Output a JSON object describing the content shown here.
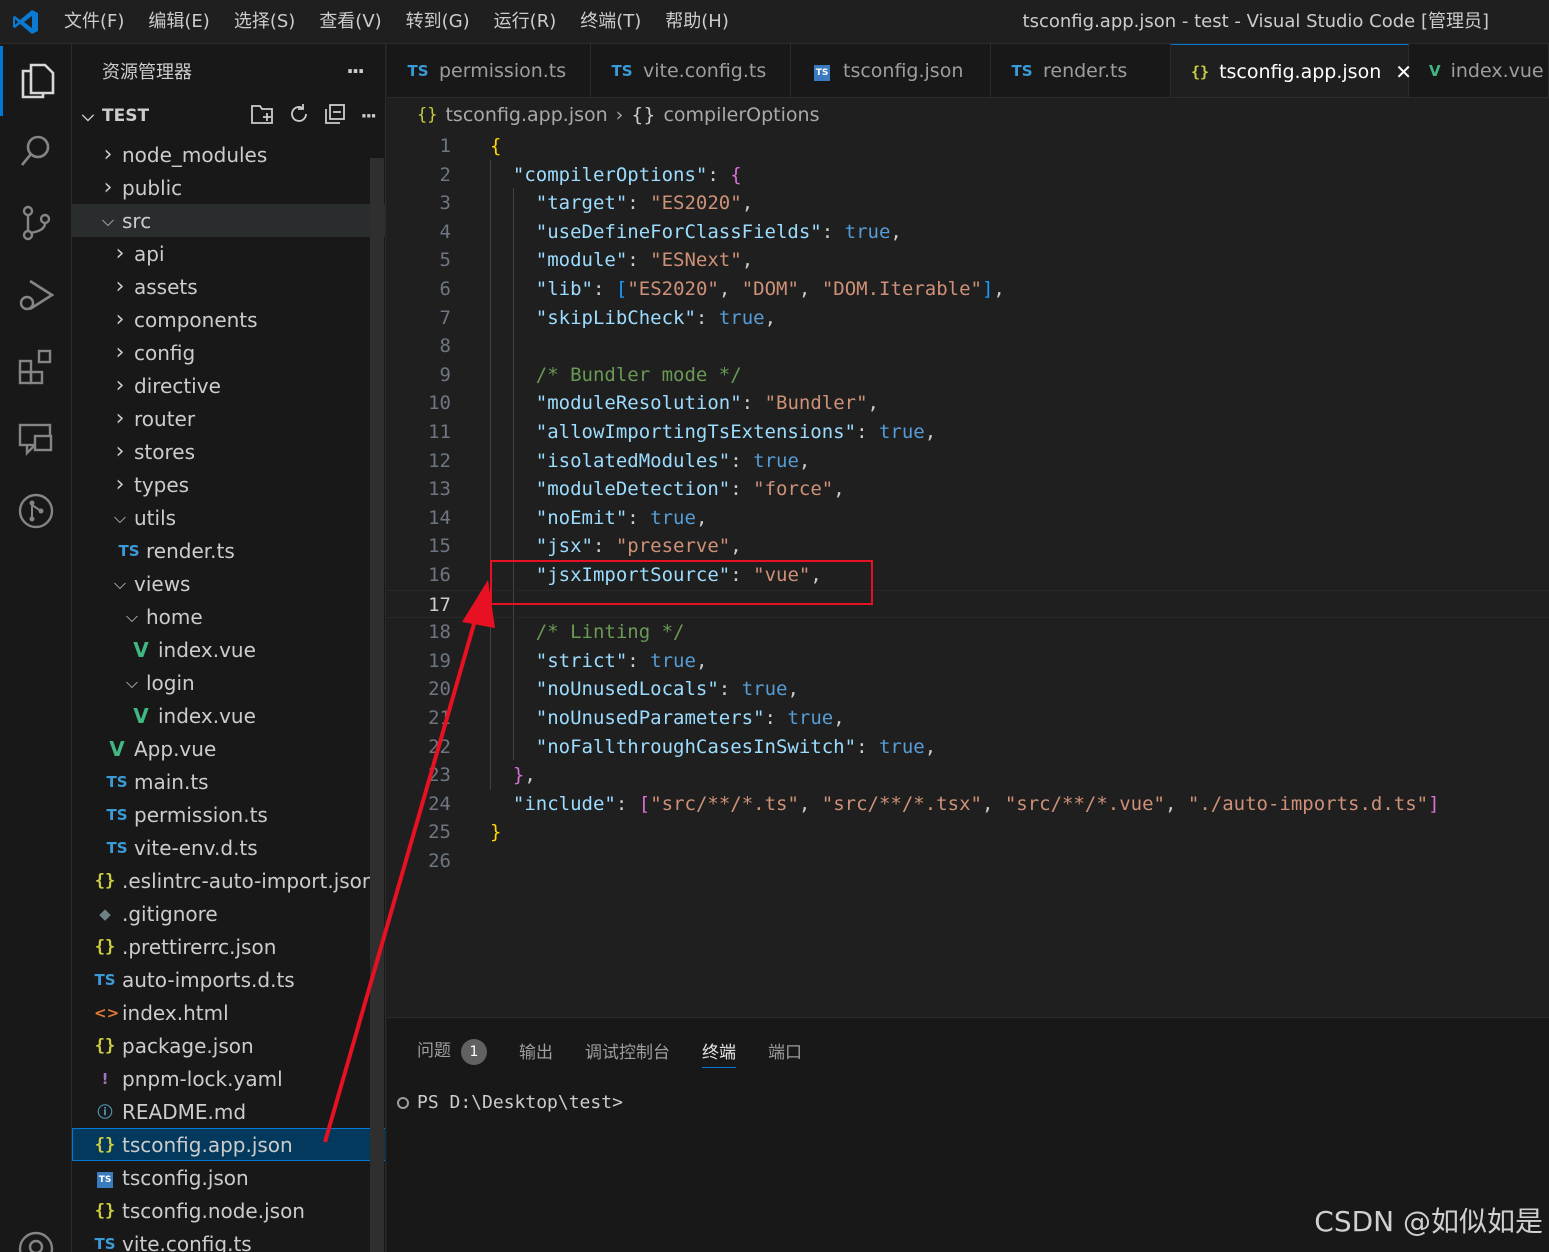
{
  "titlebar": {
    "menus": [
      "文件(F)",
      "编辑(E)",
      "选择(S)",
      "查看(V)",
      "转到(G)",
      "运行(R)",
      "终端(T)",
      "帮助(H)"
    ],
    "window_title": "tsconfig.app.json - test - Visual Studio Code [管理员]"
  },
  "activitybar": {
    "icons": [
      "explorer-icon",
      "search-icon",
      "source-control-icon",
      "run-debug-icon",
      "extensions-icon",
      "remote-chat-icon",
      "git-graph-icon",
      "account-icon"
    ]
  },
  "sidebar": {
    "title": "资源管理器",
    "more": "···",
    "section": "TEST",
    "tree": [
      {
        "label": "node_modules",
        "kind": "folder",
        "open": false
      },
      {
        "label": "public",
        "kind": "folder",
        "open": false
      },
      {
        "label": "src",
        "kind": "folder",
        "open": true
      },
      {
        "label": "api",
        "kind": "folder",
        "open": false
      },
      {
        "label": "assets",
        "kind": "folder",
        "open": false
      },
      {
        "label": "components",
        "kind": "folder",
        "open": false
      },
      {
        "label": "config",
        "kind": "folder",
        "open": false
      },
      {
        "label": "directive",
        "kind": "folder",
        "open": false
      },
      {
        "label": "router",
        "kind": "folder",
        "open": false
      },
      {
        "label": "stores",
        "kind": "folder",
        "open": false
      },
      {
        "label": "types",
        "kind": "folder",
        "open": false
      },
      {
        "label": "utils",
        "kind": "folder",
        "open": true
      },
      {
        "label": "render.ts",
        "kind": "ts"
      },
      {
        "label": "views",
        "kind": "folder",
        "open": true
      },
      {
        "label": "home",
        "kind": "folder",
        "open": true
      },
      {
        "label": "index.vue",
        "kind": "vue"
      },
      {
        "label": "login",
        "kind": "folder",
        "open": true
      },
      {
        "label": "index.vue",
        "kind": "vue"
      },
      {
        "label": "App.vue",
        "kind": "vue"
      },
      {
        "label": "main.ts",
        "kind": "ts"
      },
      {
        "label": "permission.ts",
        "kind": "ts"
      },
      {
        "label": "vite-env.d.ts",
        "kind": "ts"
      },
      {
        "label": ".eslintrc-auto-import.json",
        "kind": "json"
      },
      {
        "label": ".gitignore",
        "kind": "git"
      },
      {
        "label": ".prettirerrc.json",
        "kind": "json"
      },
      {
        "label": "auto-imports.d.ts",
        "kind": "ts"
      },
      {
        "label": "index.html",
        "kind": "html"
      },
      {
        "label": "package.json",
        "kind": "json"
      },
      {
        "label": "pnpm-lock.yaml",
        "kind": "yaml"
      },
      {
        "label": "README.md",
        "kind": "info"
      },
      {
        "label": "tsconfig.app.json",
        "kind": "json",
        "selected": true
      },
      {
        "label": "tsconfig.json",
        "kind": "tsjson"
      },
      {
        "label": "tsconfig.node.json",
        "kind": "json"
      },
      {
        "label": "vite.config.ts",
        "kind": "ts"
      }
    ]
  },
  "tabs": [
    {
      "label": "permission.ts",
      "kind": "ts"
    },
    {
      "label": "vite.config.ts",
      "kind": "ts"
    },
    {
      "label": "tsconfig.json",
      "kind": "tsjson"
    },
    {
      "label": "render.ts",
      "kind": "ts"
    },
    {
      "label": "tsconfig.app.json",
      "kind": "json",
      "active": true
    },
    {
      "label": "index.vue",
      "kind": "vue"
    }
  ],
  "breadcrumb": {
    "file": "tsconfig.app.json",
    "symbol": "compilerOptions"
  },
  "editor": {
    "current_line": 17,
    "lines": [
      [
        [
          "br1",
          "{"
        ]
      ],
      [
        [
          "p",
          "  "
        ],
        [
          "k",
          "\"compilerOptions\""
        ],
        [
          "p",
          ": "
        ],
        [
          "br2",
          "{"
        ]
      ],
      [
        [
          "p",
          "    "
        ],
        [
          "k",
          "\"target\""
        ],
        [
          "p",
          ": "
        ],
        [
          "s",
          "\"ES2020\""
        ],
        [
          "p",
          ","
        ]
      ],
      [
        [
          "p",
          "    "
        ],
        [
          "k",
          "\"useDefineForClassFields\""
        ],
        [
          "p",
          ": "
        ],
        [
          "b",
          "true"
        ],
        [
          "p",
          ","
        ]
      ],
      [
        [
          "p",
          "    "
        ],
        [
          "k",
          "\"module\""
        ],
        [
          "p",
          ": "
        ],
        [
          "s",
          "\"ESNext\""
        ],
        [
          "p",
          ","
        ]
      ],
      [
        [
          "p",
          "    "
        ],
        [
          "k",
          "\"lib\""
        ],
        [
          "p",
          ": "
        ],
        [
          "br3",
          "["
        ],
        [
          "s",
          "\"ES2020\""
        ],
        [
          "p",
          ", "
        ],
        [
          "s",
          "\"DOM\""
        ],
        [
          "p",
          ", "
        ],
        [
          "s",
          "\"DOM.Iterable\""
        ],
        [
          "br3",
          "]"
        ],
        [
          "p",
          ","
        ]
      ],
      [
        [
          "p",
          "    "
        ],
        [
          "k",
          "\"skipLibCheck\""
        ],
        [
          "p",
          ": "
        ],
        [
          "b",
          "true"
        ],
        [
          "p",
          ","
        ]
      ],
      [],
      [
        [
          "p",
          "    "
        ],
        [
          "c",
          "/* Bundler mode */"
        ]
      ],
      [
        [
          "p",
          "    "
        ],
        [
          "k",
          "\"moduleResolution\""
        ],
        [
          "p",
          ": "
        ],
        [
          "s",
          "\"Bundler\""
        ],
        [
          "p",
          ","
        ]
      ],
      [
        [
          "p",
          "    "
        ],
        [
          "k",
          "\"allowImportingTsExtensions\""
        ],
        [
          "p",
          ": "
        ],
        [
          "b",
          "true"
        ],
        [
          "p",
          ","
        ]
      ],
      [
        [
          "p",
          "    "
        ],
        [
          "k",
          "\"isolatedModules\""
        ],
        [
          "p",
          ": "
        ],
        [
          "b",
          "true"
        ],
        [
          "p",
          ","
        ]
      ],
      [
        [
          "p",
          "    "
        ],
        [
          "k",
          "\"moduleDetection\""
        ],
        [
          "p",
          ": "
        ],
        [
          "s",
          "\"force\""
        ],
        [
          "p",
          ","
        ]
      ],
      [
        [
          "p",
          "    "
        ],
        [
          "k",
          "\"noEmit\""
        ],
        [
          "p",
          ": "
        ],
        [
          "b",
          "true"
        ],
        [
          "p",
          ","
        ]
      ],
      [
        [
          "p",
          "    "
        ],
        [
          "k",
          "\"jsx\""
        ],
        [
          "p",
          ": "
        ],
        [
          "s",
          "\"preserve\""
        ],
        [
          "p",
          ","
        ]
      ],
      [
        [
          "p",
          "    "
        ],
        [
          "k",
          "\"jsxImportSource\""
        ],
        [
          "p",
          ": "
        ],
        [
          "s",
          "\"vue\""
        ],
        [
          "p",
          ","
        ]
      ],
      [],
      [
        [
          "p",
          "    "
        ],
        [
          "c",
          "/* Linting */"
        ]
      ],
      [
        [
          "p",
          "    "
        ],
        [
          "k",
          "\"strict\""
        ],
        [
          "p",
          ": "
        ],
        [
          "b",
          "true"
        ],
        [
          "p",
          ","
        ]
      ],
      [
        [
          "p",
          "    "
        ],
        [
          "k",
          "\"noUnusedLocals\""
        ],
        [
          "p",
          ": "
        ],
        [
          "b",
          "true"
        ],
        [
          "p",
          ","
        ]
      ],
      [
        [
          "p",
          "    "
        ],
        [
          "k",
          "\"noUnusedParameters\""
        ],
        [
          "p",
          ": "
        ],
        [
          "b",
          "true"
        ],
        [
          "p",
          ","
        ]
      ],
      [
        [
          "p",
          "    "
        ],
        [
          "k",
          "\"noFallthroughCasesInSwitch\""
        ],
        [
          "p",
          ": "
        ],
        [
          "b",
          "true"
        ],
        [
          "p",
          ","
        ]
      ],
      [
        [
          "p",
          "  "
        ],
        [
          "br2",
          "}"
        ],
        [
          "p",
          ","
        ]
      ],
      [
        [
          "p",
          "  "
        ],
        [
          "k",
          "\"include\""
        ],
        [
          "p",
          ": "
        ],
        [
          "br2",
          "["
        ],
        [
          "s",
          "\"src/**/*.ts\""
        ],
        [
          "p",
          ", "
        ],
        [
          "s",
          "\"src/**/*.tsx\""
        ],
        [
          "p",
          ", "
        ],
        [
          "s",
          "\"src/**/*.vue\""
        ],
        [
          "p",
          ", "
        ],
        [
          "s",
          "\"./auto-imports.d.ts\""
        ],
        [
          "br2",
          "]"
        ]
      ],
      [
        [
          "br1",
          "}"
        ]
      ],
      []
    ]
  },
  "panel": {
    "tabs": [
      "问题",
      "输出",
      "调试控制台",
      "终端",
      "端口"
    ],
    "problems_count": "1",
    "active_tab": "终端",
    "terminal_prompt": "PS D:\\Desktop\\test>"
  },
  "watermark": "CSDN @如似如是",
  "colors": {
    "accent": "#0078d4",
    "highlight_box": "#e81123",
    "arrow": "#e81123"
  }
}
